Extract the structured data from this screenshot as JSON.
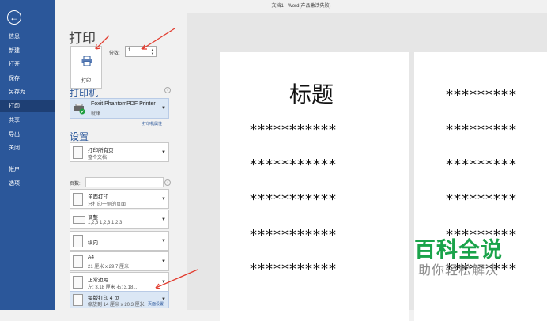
{
  "window": {
    "title": "文档1 - Word(产品激活失败)"
  },
  "nav": {
    "back_icon": "back-arrow-icon",
    "items": [
      {
        "label": "信息"
      },
      {
        "label": "新建"
      },
      {
        "label": "打开"
      },
      {
        "label": "保存"
      },
      {
        "label": "另存为"
      },
      {
        "label": "打印",
        "active": true
      },
      {
        "label": "共享"
      },
      {
        "label": "导出"
      },
      {
        "label": "关闭"
      },
      {
        "label": "帐户"
      },
      {
        "label": "选项"
      }
    ]
  },
  "print": {
    "heading": "打印",
    "button_label": "打印",
    "copies_label": "份数:",
    "copies_value": "1"
  },
  "printer": {
    "section": "打印机",
    "name": "Foxit PhantomPDF Printer",
    "status": "就绪",
    "properties_link": "打印机属性"
  },
  "settings": {
    "section": "设置",
    "pages_label": "页数:",
    "pages_value": "",
    "dropdowns": [
      {
        "l1": "打印所有页",
        "l2": "整个文档"
      },
      {
        "l1": "单面打印",
        "l2": "只打印一侧的页面"
      },
      {
        "l1": "调整",
        "l2": "1,2,3    1,2,3    1,2,3"
      },
      {
        "l1": "纵向",
        "l2": ""
      },
      {
        "l1": "A4",
        "l2": "21 厘米 x 29.7 厘米"
      },
      {
        "l1": "正常边距",
        "l2": "左: 3.18 厘米   右: 3.18..."
      },
      {
        "l1": "每版打印 4 页",
        "l2": "缩放到 14 厘米 x 20.3 厘米"
      }
    ],
    "page_setup_link": "页面设置"
  },
  "preview": {
    "page1": {
      "title": "标题",
      "lines": [
        "***********",
        "***********",
        "***********",
        "***********",
        "***********"
      ]
    },
    "page2": {
      "lines": [
        "*********",
        "*********",
        "*********",
        "*********",
        "*********",
        "*********"
      ]
    }
  },
  "watermark": {
    "line1": "百科全说",
    "line2": "助你轻松解决"
  },
  "colors": {
    "accent": "#2b579a",
    "arrow": "#e23b2e",
    "watermark_green": "#1aa34a"
  }
}
